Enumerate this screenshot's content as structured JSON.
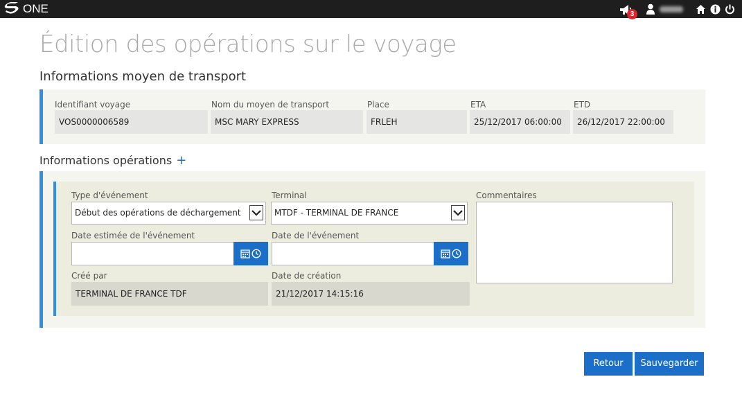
{
  "app": {
    "logo_text": "ONE",
    "notifications_count": "3"
  },
  "page": {
    "title": "Édition des opérations sur le voyage"
  },
  "transport": {
    "section_title": "Informations moyen de transport",
    "fields": [
      {
        "label": "Identifiant voyage",
        "value": "VOS0000006589"
      },
      {
        "label": "Nom du moyen de transport",
        "value": "MSC MARY EXPRESS"
      },
      {
        "label": "Place",
        "value": "FRLEH"
      },
      {
        "label": "ETA",
        "value": "25/12/2017 06:00:00"
      },
      {
        "label": "ETD",
        "value": "26/12/2017 22:00:00"
      }
    ]
  },
  "operations": {
    "section_title": "Informations opérations",
    "add_label": "+",
    "event_type": {
      "label": "Type d'événement",
      "value": "Début des opérations de déchargement"
    },
    "terminal": {
      "label": "Terminal",
      "value": "MTDF - TERMINAL DE FRANCE"
    },
    "comments": {
      "label": "Commentaires",
      "value": ""
    },
    "estimated_date": {
      "label": "Date estimée de l'événement",
      "value": ""
    },
    "event_date": {
      "label": "Date de l'événement",
      "value": ""
    },
    "created_by": {
      "label": "Créé par",
      "value": "TERMINAL DE FRANCE TDF"
    },
    "creation_date": {
      "label": "Date de création",
      "value": "21/12/2017 14:15:16"
    }
  },
  "actions": {
    "back_label": "Retour",
    "save_label": "Sauvegarder"
  },
  "colors": {
    "accent": "#1c6fc8",
    "panel_accent": "#2f8fe0",
    "topbar": "#1e1e1e",
    "badge": "#e2222a"
  },
  "icons": [
    "logo-s-icon",
    "megaphone-icon",
    "user-icon",
    "home-icon",
    "info-icon",
    "power-icon",
    "chevron-down-icon",
    "calendar-icon",
    "clock-icon"
  ]
}
